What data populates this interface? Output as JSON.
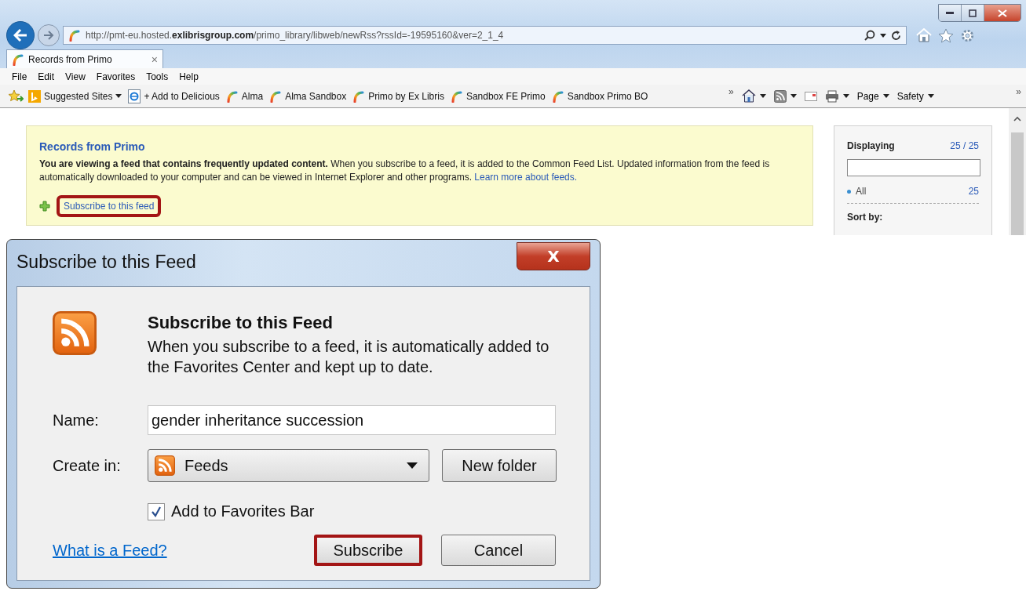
{
  "browser": {
    "address_bar": {
      "url": "http://pmt-eu.hosted.**exlibrisgroup.com**/primo_library/libweb/newRss?rssId=-19595160&ver=2_1_4"
    },
    "tabs": [
      {
        "label": "Records from Primo",
        "close": "×",
        "selected": true
      }
    ],
    "menu": [
      "File",
      "Edit",
      "View",
      "Favorites",
      "Tools",
      "Help"
    ],
    "favorites_bar": [
      {
        "kind": "dropdown",
        "label": "Suggested Sites"
      },
      {
        "kind": "link",
        "label": "+ Add to Delicious"
      },
      {
        "kind": "link",
        "label": "Alma"
      },
      {
        "kind": "link",
        "label": "Alma Sandbox"
      },
      {
        "kind": "link",
        "label": "Primo by Ex Libris"
      },
      {
        "kind": "link",
        "label": "Sandbox FE Primo"
      },
      {
        "kind": "link",
        "label": "Sandbox Primo BO"
      }
    ],
    "overflow": "»",
    "command_bar": [
      {
        "kind": "icon",
        "dropdown": true
      },
      {
        "kind": "icon",
        "dropdown": true
      },
      {
        "kind": "icon",
        "dropdown": false
      },
      {
        "kind": "icon",
        "dropdown": true
      },
      {
        "kind": "text",
        "label": "Page",
        "dropdown": true
      },
      {
        "kind": "text",
        "label": "Safety",
        "dropdown": true
      }
    ],
    "command_overflow": "»"
  },
  "feed_page": {
    "title": "Records from Primo",
    "description": "**You are viewing a feed that contains frequently updated content.** When you subscribe to a feed, it is added to the Common Feed List. Updated information from the feed is automatically downloaded to your computer and can be viewed in Internet Explorer and other programs.",
    "learn_more": "Learn more about feeds.",
    "subscribe_link": {
      "label": "Subscribe to this feed",
      "highlighted": true
    },
    "sidebar": {
      "displaying": "Displaying",
      "count": "25 / 25",
      "filters": [
        {
          "label": "All",
          "count": "25"
        }
      ],
      "sort_by": "Sort by:"
    }
  },
  "dialog": {
    "title": "Subscribe to this Feed",
    "close": "X",
    "heading": "Subscribe to this Feed",
    "description": "When you subscribe to a feed, it is automatically added to the Favorites Center and kept up to date.",
    "name_label": "Name:",
    "name_value": "gender inheritance succession",
    "create_in_label": "Create in:",
    "create_in_value": "Feeds",
    "new_folder": "New folder",
    "add_to_favorites_bar": {
      "label": "Add to Favorites Bar",
      "checked": true
    },
    "help_link": "What is a Feed?",
    "buttons": [
      {
        "label": "Subscribe",
        "default": true,
        "highlighted": true
      },
      {
        "label": "Cancel",
        "default": false,
        "highlighted": false
      }
    ]
  }
}
